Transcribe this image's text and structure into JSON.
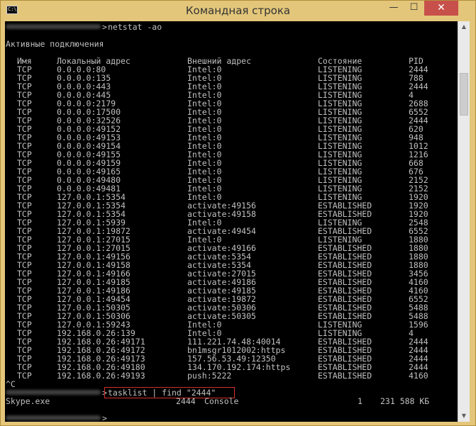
{
  "window": {
    "title": "Командная строка",
    "app_icon_text": "C:\\",
    "minimize_glyph": "—",
    "maximize_glyph": "☐",
    "close_glyph": "✕"
  },
  "scrollbar": {
    "up_glyph": "▲",
    "down_glyph": "▼"
  },
  "console": {
    "command1": "netstat -ao",
    "section_title": "Активные подключения",
    "headers": [
      "Имя",
      "Локальный адрес",
      "Внешний адрес",
      "Состояние",
      "PID"
    ],
    "rows": [
      [
        "TCP",
        "0.0.0.0:80",
        "Intel:0",
        "LISTENING",
        "2444"
      ],
      [
        "TCP",
        "0.0.0.0:135",
        "Intel:0",
        "LISTENING",
        "788"
      ],
      [
        "TCP",
        "0.0.0.0:443",
        "Intel:0",
        "LISTENING",
        "2444"
      ],
      [
        "TCP",
        "0.0.0.0:445",
        "Intel:0",
        "LISTENING",
        "4"
      ],
      [
        "TCP",
        "0.0.0.0:2179",
        "Intel:0",
        "LISTENING",
        "2688"
      ],
      [
        "TCP",
        "0.0.0.0:17500",
        "Intel:0",
        "LISTENING",
        "6552"
      ],
      [
        "TCP",
        "0.0.0.0:32526",
        "Intel:0",
        "LISTENING",
        "2444"
      ],
      [
        "TCP",
        "0.0.0.0:49152",
        "Intel:0",
        "LISTENING",
        "620"
      ],
      [
        "TCP",
        "0.0.0.0:49153",
        "Intel:0",
        "LISTENING",
        "948"
      ],
      [
        "TCP",
        "0.0.0.0:49154",
        "Intel:0",
        "LISTENING",
        "1012"
      ],
      [
        "TCP",
        "0.0.0.0:49155",
        "Intel:0",
        "LISTENING",
        "1216"
      ],
      [
        "TCP",
        "0.0.0.0:49159",
        "Intel:0",
        "LISTENING",
        "668"
      ],
      [
        "TCP",
        "0.0.0.0:49165",
        "Intel:0",
        "LISTENING",
        "676"
      ],
      [
        "TCP",
        "0.0.0.0:49480",
        "Intel:0",
        "LISTENING",
        "2152"
      ],
      [
        "TCP",
        "0.0.0.0:49481",
        "Intel:0",
        "LISTENING",
        "2152"
      ],
      [
        "TCP",
        "127.0.0.1:5354",
        "Intel:0",
        "LISTENING",
        "1920"
      ],
      [
        "TCP",
        "127.0.0.1:5354",
        "activate:49156",
        "ESTABLISHED",
        "1920"
      ],
      [
        "TCP",
        "127.0.0.1:5354",
        "activate:49158",
        "ESTABLISHED",
        "1920"
      ],
      [
        "TCP",
        "127.0.0.1:5939",
        "Intel:0",
        "LISTENING",
        "2548"
      ],
      [
        "TCP",
        "127.0.0.1:19872",
        "activate:49454",
        "ESTABLISHED",
        "6552"
      ],
      [
        "TCP",
        "127.0.0.1:27015",
        "Intel:0",
        "LISTENING",
        "1880"
      ],
      [
        "TCP",
        "127.0.0.1:27015",
        "activate:49166",
        "ESTABLISHED",
        "1880"
      ],
      [
        "TCP",
        "127.0.0.1:49156",
        "activate:5354",
        "ESTABLISHED",
        "1880"
      ],
      [
        "TCP",
        "127.0.0.1:49158",
        "activate:5354",
        "ESTABLISHED",
        "1880"
      ],
      [
        "TCP",
        "127.0.0.1:49166",
        "activate:27015",
        "ESTABLISHED",
        "3456"
      ],
      [
        "TCP",
        "127.0.0.1:49185",
        "activate:49186",
        "ESTABLISHED",
        "4160"
      ],
      [
        "TCP",
        "127.0.0.1:49186",
        "activate:49185",
        "ESTABLISHED",
        "4160"
      ],
      [
        "TCP",
        "127.0.0.1:49454",
        "activate:19872",
        "ESTABLISHED",
        "6552"
      ],
      [
        "TCP",
        "127.0.0.1:50305",
        "activate:50306",
        "ESTABLISHED",
        "5488"
      ],
      [
        "TCP",
        "127.0.0.1:50306",
        "activate:50305",
        "ESTABLISHED",
        "5488"
      ],
      [
        "TCP",
        "127.0.0.1:59243",
        "Intel:0",
        "LISTENING",
        "1596"
      ],
      [
        "TCP",
        "192.168.0.26:139",
        "Intel:0",
        "LISTENING",
        "4"
      ],
      [
        "TCP",
        "192.168.0.26:49171",
        "111.221.74.48:40014",
        "ESTABLISHED",
        "2444"
      ],
      [
        "TCP",
        "192.168.0.26:49172",
        "bn1msgr1012002:https",
        "ESTABLISHED",
        "2444"
      ],
      [
        "TCP",
        "192.168.0.26:49173",
        "157.56.53.49:12350",
        "ESTABLISHED",
        "2444"
      ],
      [
        "TCP",
        "192.168.0.26:49180",
        "134.170.192.174:https",
        "ESTABLISHED",
        "2444"
      ],
      [
        "TCP",
        "192.168.0.26:49193",
        "push:5222",
        "ESTABLISHED",
        "4160"
      ]
    ],
    "interrupt": "^C",
    "command2": "tasklist | find \"2444\"",
    "result": {
      "image": "Skype.exe",
      "pid": "2444",
      "session": "Console",
      "session_num": "1",
      "mem": "231 588 КБ"
    },
    "prompt_suffix": ">"
  }
}
